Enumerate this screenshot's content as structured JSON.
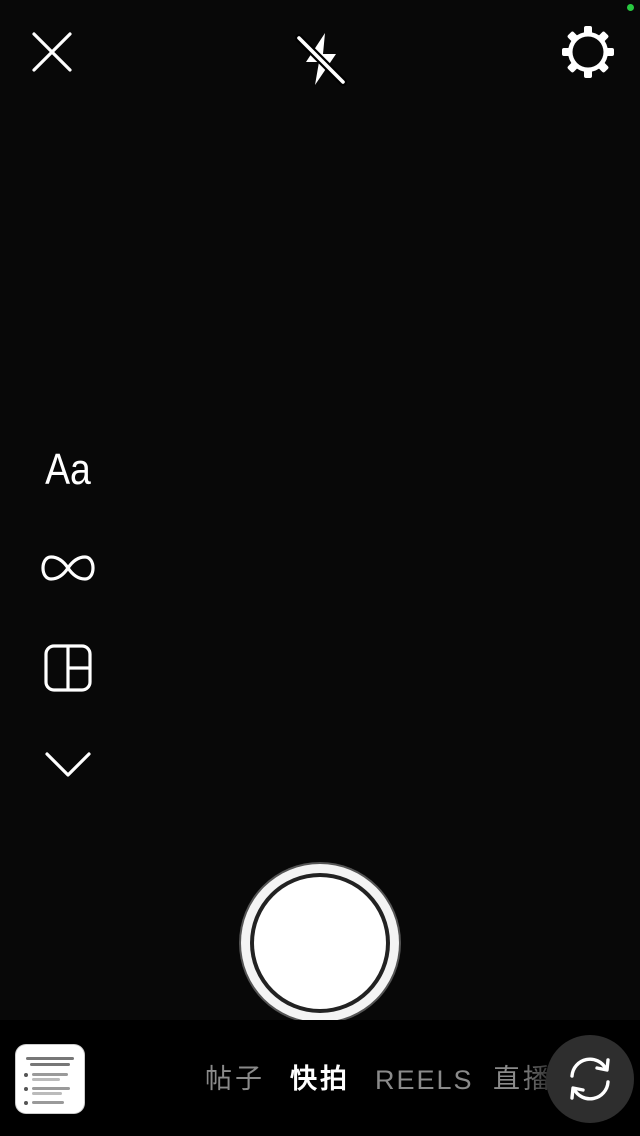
{
  "status": {
    "indicator_color": "#28c840"
  },
  "top_bar": {
    "close_icon": "close-icon",
    "flash_icon": "flash-off-icon",
    "settings_icon": "gear-icon"
  },
  "side_tools": {
    "create_label": "Aa",
    "boomerang_icon": "infinity-icon",
    "layout_icon": "layout-grid-icon",
    "more_icon": "chevron-down-icon"
  },
  "capture": {
    "shutter_icon": "shutter-button"
  },
  "bottom_bar": {
    "gallery_icon": "gallery-thumbnail",
    "modes": [
      "帖子",
      "快拍",
      "REELS",
      "直播"
    ],
    "active_mode": "快拍",
    "flip_icon": "camera-flip-icon"
  },
  "colors": {
    "background": "#000000",
    "active_tab": "#ffffff",
    "inactive_tab": "#8a8a8a",
    "flip_button_bg": "#2e2e2e"
  }
}
